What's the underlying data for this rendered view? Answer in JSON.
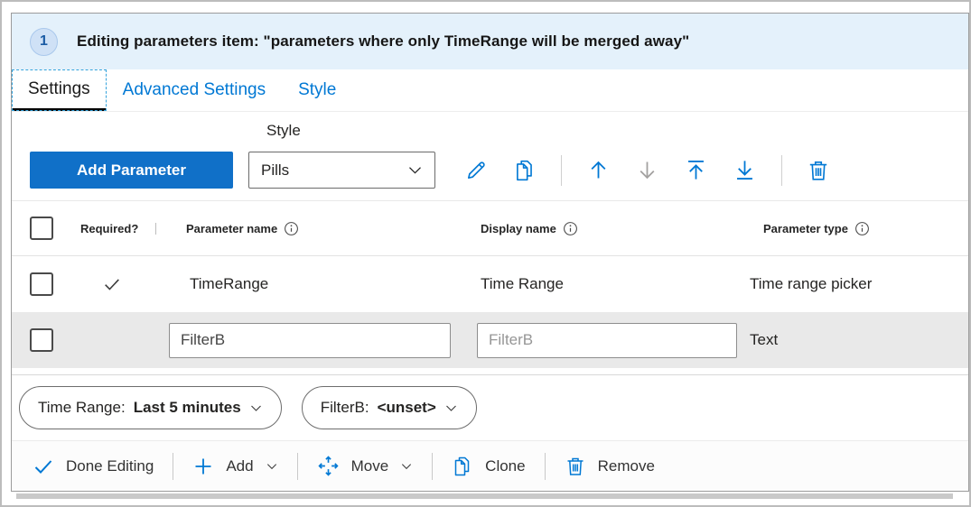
{
  "colors": {
    "accent": "#0078d4",
    "header_bg": "#e4f1fb",
    "add_button_bg": "#1070c8",
    "selected_row_bg": "#e9e9e9",
    "disabled_icon": "#a3a1a0"
  },
  "header": {
    "step_number": "1",
    "title": "Editing parameters item: \"parameters where only TimeRange will be merged away\""
  },
  "tabs": [
    {
      "label": "Settings",
      "active": true
    },
    {
      "label": "Advanced Settings",
      "active": false
    },
    {
      "label": "Style",
      "active": false
    }
  ],
  "toolbar": {
    "add_parameter_label": "Add Parameter",
    "style_label": "Style",
    "style_value": "Pills",
    "icon_actions": [
      "edit",
      "clone",
      "move-up",
      "move-down",
      "move-to-top",
      "move-to-bottom",
      "delete"
    ],
    "disabled_actions": [
      "move-down"
    ]
  },
  "table": {
    "headers": {
      "required": "Required?",
      "name": "Parameter name",
      "display": "Display name",
      "type": "Parameter type"
    },
    "rows": [
      {
        "required": true,
        "name": "TimeRange",
        "display_name": "Time Range",
        "type": "Time range picker",
        "state": "saved"
      },
      {
        "required": false,
        "name_value": "FilterB",
        "display_placeholder": "FilterB",
        "type": "Text",
        "state": "editing"
      }
    ]
  },
  "preview_pills": [
    {
      "label": "Time Range:",
      "value": "Last 5 minutes"
    },
    {
      "label": "FilterB:",
      "value": "<unset>"
    }
  ],
  "footer": {
    "items": [
      {
        "label": "Done Editing",
        "icon": "check"
      },
      {
        "label": "Add",
        "icon": "plus",
        "has_dropdown": true
      },
      {
        "label": "Move",
        "icon": "move",
        "has_dropdown": true
      },
      {
        "label": "Clone",
        "icon": "clone"
      },
      {
        "label": "Remove",
        "icon": "delete"
      }
    ]
  }
}
